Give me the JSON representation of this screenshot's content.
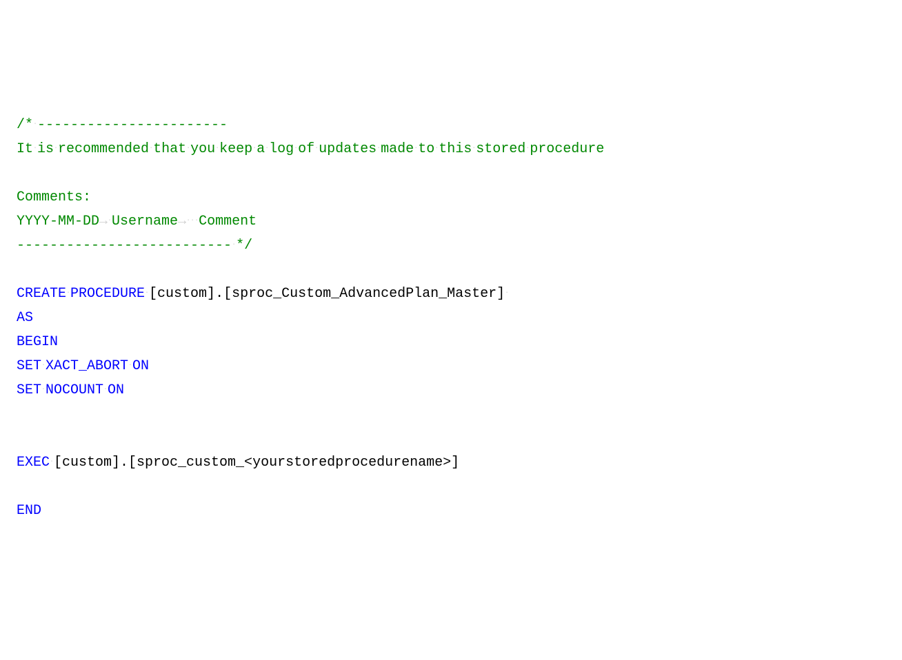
{
  "code": {
    "line1": {
      "t1": "/*",
      "t2": "-----------------------"
    },
    "line2": {
      "t1": "It",
      "t2": "is",
      "t3": "recommended",
      "t4": "that",
      "t5": "you",
      "t6": "keep",
      "t7": "a",
      "t8": "log",
      "t9": "of",
      "t10": "updates",
      "t11": "made",
      "t12": "to",
      "t13": "this",
      "t14": "stored",
      "t15": "procedure"
    },
    "line4": {
      "t1": "Comments:"
    },
    "line5": {
      "t1": "YYYY-MM-DD",
      "t2": "Username",
      "t3": "Comment"
    },
    "line6": {
      "t1": "--------------------------",
      "t2": "*/"
    },
    "line8": {
      "kw1": "CREATE",
      "kw2": "PROCEDURE",
      "id1": "[custom].[sproc_Custom_AdvancedPlan_Master]"
    },
    "line9": {
      "kw1": "AS"
    },
    "line10": {
      "kw1": "BEGIN"
    },
    "line11": {
      "kw1": "SET",
      "kw2": "XACT_ABORT",
      "kw3": "ON"
    },
    "line12": {
      "kw1": "SET",
      "kw2": "NOCOUNT",
      "kw3": "ON"
    },
    "line15": {
      "kw1": "EXEC",
      "id1": "[custom].[sproc_custom_<yourstoredprocedurename>]"
    },
    "line17": {
      "kw1": "END"
    }
  },
  "glyphs": {
    "dot": "·",
    "tab": "→"
  }
}
